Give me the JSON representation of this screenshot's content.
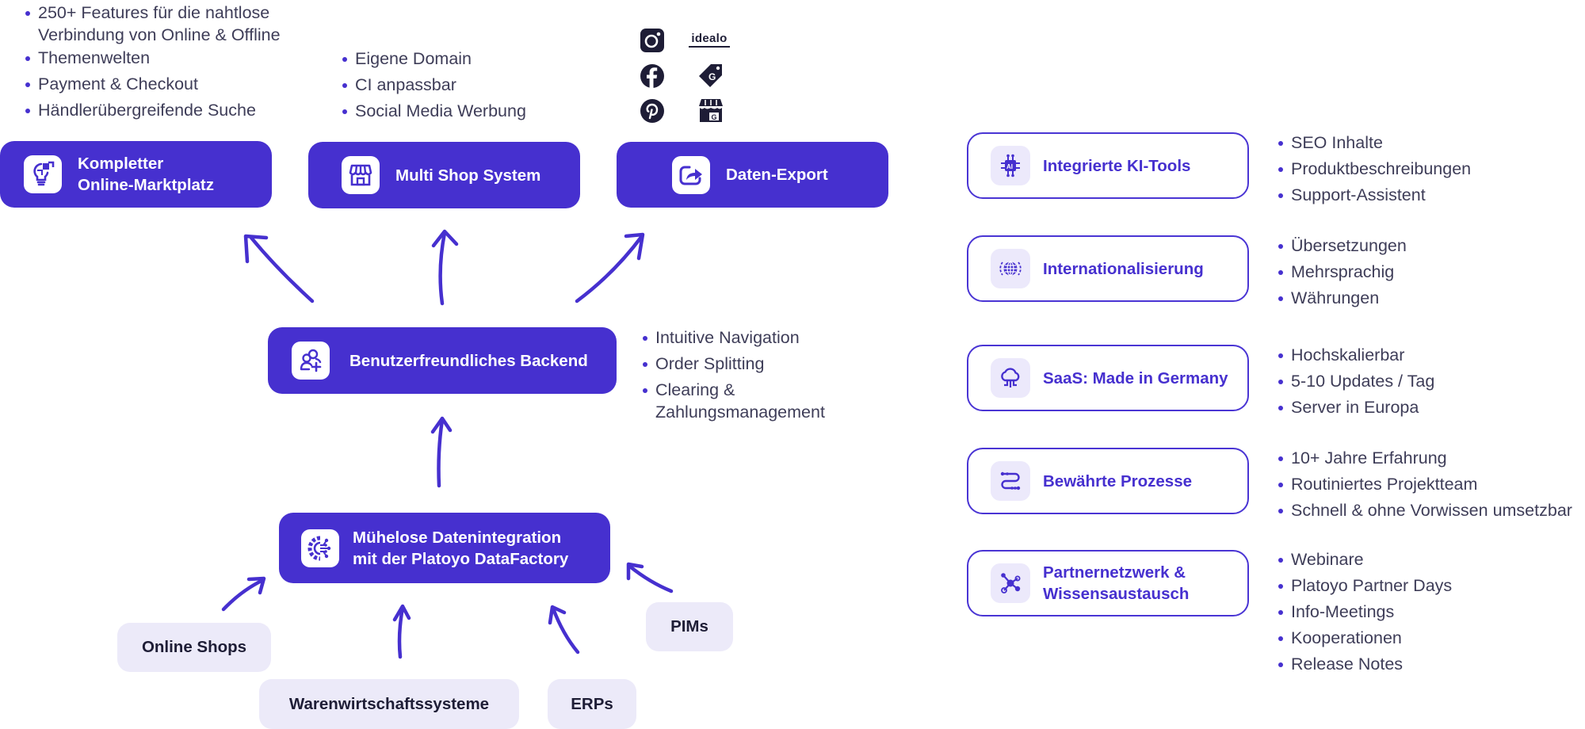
{
  "colors": {
    "primary": "#4630cf",
    "source_bg": "#eceaf9",
    "icon_bg": "#ece9fb",
    "text": "#3e3d58",
    "dark": "#1e1d36"
  },
  "top_boxes": [
    {
      "label_line1": "Kompletter",
      "label_line2": "Online-Marktplatz",
      "icon": "lightbulb-puzzle-icon",
      "bullets": [
        "250+ Features für die nahtlose",
        "Verbindung von Online & Offline",
        "Themenwelten",
        "Payment & Checkout",
        "Händlerübergreifende Suche"
      ]
    },
    {
      "label": "Multi Shop System",
      "icon": "storefront-icon",
      "bullets": [
        "Eigene Domain",
        "CI anpassbar",
        "Social Media Werbung"
      ]
    },
    {
      "label": "Daten-Export",
      "icon": "share-export-icon",
      "channels": [
        "instagram",
        "idealo",
        "facebook",
        "google-shopping",
        "pinterest",
        "google-business"
      ],
      "idealo_label": "idealo"
    }
  ],
  "backend": {
    "label": "Benutzerfreundliches Backend",
    "icon": "users-add-icon",
    "bullets": [
      "Intuitive Navigation",
      "Order Splitting",
      "Clearing &",
      "Zahlungsmanagement"
    ]
  },
  "datafactory": {
    "label_line1": "Mühelose Datenintegration",
    "label_line2": "mit der Platoyo DataFactory",
    "icon": "gear-network-icon"
  },
  "sources": [
    "Online Shops",
    "Warenwirtschaftssysteme",
    "ERPs",
    "PIMs"
  ],
  "features": [
    {
      "label": "Integrierte KI-Tools",
      "icon": "ai-chip-icon",
      "bullets": [
        "SEO Inhalte",
        "Produktbeschreibungen",
        "Support-Assistent"
      ]
    },
    {
      "label": "Internationalisierung",
      "icon": "globe-icon",
      "bullets": [
        "Übersetzungen",
        "Mehrsprachig",
        "Währungen"
      ]
    },
    {
      "label": "SaaS: Made in Germany",
      "icon": "cloud-icon",
      "bullets": [
        "Hochskalierbar",
        "5-10 Updates / Tag",
        "Server in Europa"
      ]
    },
    {
      "label": "Bewährte Prozesse",
      "icon": "process-flow-icon",
      "bullets": [
        "10+ Jahre Erfahrung",
        "Routiniertes Projektteam",
        "Schnell & ohne Vorwissen umsetzbar"
      ]
    },
    {
      "label_line1": "Partnernetzwerk &",
      "label_line2": "Wissensaustausch",
      "icon": "network-icon",
      "bullets": [
        "Webinare",
        "Platoyo Partner Days",
        "Info-Meetings",
        "Kooperationen",
        "Release Notes"
      ]
    }
  ]
}
